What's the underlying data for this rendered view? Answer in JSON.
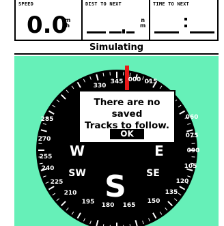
{
  "fields": [
    {
      "label": "SPEED",
      "value": "0.0",
      "unit_top": "m",
      "unit_bottom": "h"
    },
    {
      "label": "DIST TO NEXT",
      "unit_top": "n",
      "unit_bottom": "m"
    },
    {
      "label": "TIME TO NEXT"
    }
  ],
  "status": "Simulating",
  "compass": {
    "ticks": [
      "345",
      "000",
      "015",
      "330",
      "060",
      "285",
      "075",
      "270",
      "090",
      "255",
      "105",
      "240",
      "120",
      "225",
      "135",
      "210",
      "150",
      "195",
      "180",
      "165"
    ],
    "cardinals": [
      "W",
      "E",
      "SW",
      "SE",
      "S"
    ],
    "heading_color": "#e81818",
    "background": "#66f0b8"
  },
  "dialog": {
    "line1": "There are no saved",
    "line2": "Tracks to follow.",
    "ok_label": "OK"
  }
}
